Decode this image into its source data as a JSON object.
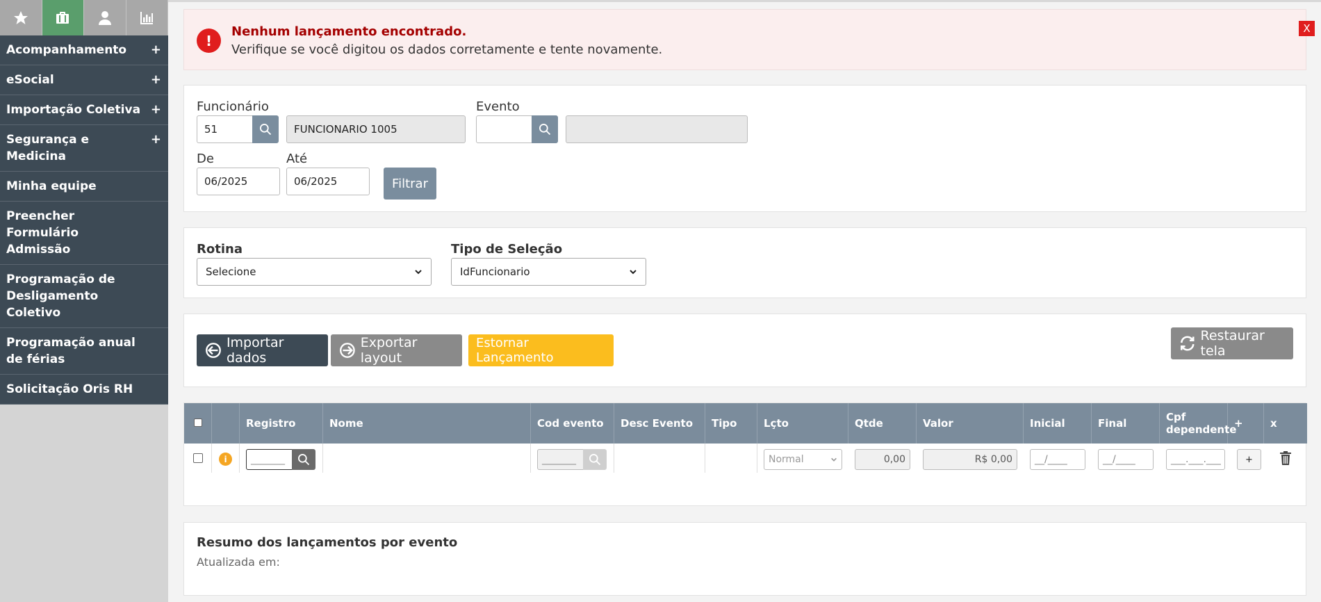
{
  "sidebar": {
    "tabs": [
      {
        "icon": "star-icon"
      },
      {
        "icon": "briefcase-icon"
      },
      {
        "icon": "user-icon"
      },
      {
        "icon": "bar-chart-icon"
      }
    ],
    "items": [
      {
        "label": "Acompanhamento",
        "expand": "+"
      },
      {
        "label": "eSocial",
        "expand": "+"
      },
      {
        "label": "Importação Coletiva",
        "expand": "+"
      },
      {
        "label": "Segurança e Medicina",
        "expand": "+"
      },
      {
        "label": "Minha equipe",
        "expand": ""
      },
      {
        "label": "Preencher Formulário Admissão",
        "expand": ""
      },
      {
        "label": "Programação de Desligamento Coletivo",
        "expand": ""
      },
      {
        "label": "Programação anual de férias",
        "expand": ""
      },
      {
        "label": "Solicitação Oris RH",
        "expand": ""
      }
    ]
  },
  "alert": {
    "icon_text": "!",
    "title": "Nenhum lançamento encontrado.",
    "message": "Verifique se você digitou os dados corretamente e tente novamente.",
    "close_label": "X"
  },
  "filter": {
    "employee_label": "Funcionário",
    "employee_code": "51",
    "employee_name": "FUNCIONARIO 1005",
    "event_label": "Evento",
    "event_code": "",
    "event_desc": "",
    "from_label": "De",
    "from_value": "06/2025",
    "to_label": "Até",
    "to_value": "06/2025",
    "filter_button": "Filtrar"
  },
  "routine": {
    "rotina_label": "Rotina",
    "rotina_value": "Selecione",
    "tipo_label": "Tipo de Seleção",
    "tipo_value": "IdFuncionario"
  },
  "actions": {
    "import_label": "Importar dados",
    "export_label": "Exportar layout",
    "reverse_label": "Estornar Lançamento",
    "restore_label": "Restaurar tela"
  },
  "table": {
    "headers": {
      "registro": "Registro",
      "nome": "Nome",
      "cod_evento": "Cod evento",
      "desc_evento": "Desc Evento",
      "tipo": "Tipo",
      "lcto": "Lçto",
      "qtde": "Qtde",
      "valor": "Valor",
      "inicial": "Inicial",
      "final": "Final",
      "cpf": "Cpf dependente",
      "add": "+",
      "remove": "x"
    },
    "row": {
      "info_icon": "i",
      "registro_placeholder": "_______",
      "cod_evento_placeholder": "_______",
      "lcto_value": "Normal",
      "qtde_value": "0,00",
      "valor_value": "R$ 0,00",
      "inicial_placeholder": "__/____",
      "final_placeholder": "__/____",
      "cpf_placeholder": "___.___.___",
      "add_label": "+"
    }
  },
  "summary": {
    "title": "Resumo dos lançamentos por evento",
    "updated_label": "Atualizada em:"
  },
  "colors": {
    "sidebar_item": "#3d4a55",
    "active_tab": "#5a9e6c",
    "primary_dark": "#3d4a55",
    "secondary_gray": "#8a8a8a",
    "warning_yellow": "#fbbd1e",
    "alert_red": "#e01d1d",
    "table_header": "#7b8c9c"
  }
}
